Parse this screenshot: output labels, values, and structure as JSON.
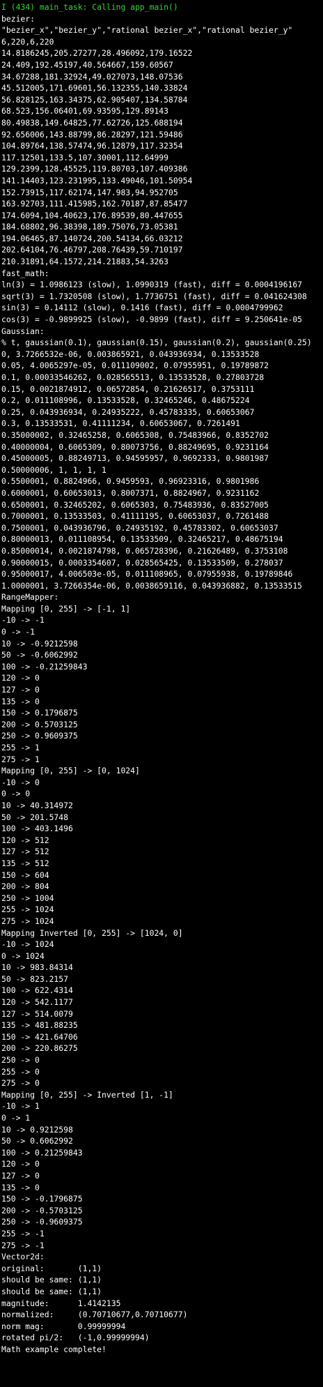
{
  "header": {
    "text": "I (434) main_task: Calling app_main()",
    "color": "#2fd92f"
  },
  "text_color": "#ffffff",
  "background": "#000000",
  "lines": [
    "bezier:",
    "\"bezier_x\",\"bezier_y\",\"rational bezier_x\",\"rational bezier_y\"",
    "6,220,6,220",
    "14.8186245,205.27277,28.496092,179.16522",
    "24.409,192.45197,40.564667,159.60567",
    "34.67288,181.32924,49.027073,148.07536",
    "45.512005,171.69601,56.132355,140.33824",
    "56.828125,163.34375,62.905407,134.58784",
    "68.523,156.06401,69.93595,129.89143",
    "80.49838,149.64825,77.62726,125.688194",
    "92.656006,143.88799,86.28297,121.59486",
    "104.89764,138.57474,96.12879,117.32354",
    "117.12501,133.5,107.30001,112.64999",
    "129.2399,128.45525,119.80703,107.409386",
    "141.14403,123.231995,133.49046,101.50954",
    "152.73915,117.62174,147.983,94.952705",
    "163.92703,111.415985,162.70187,87.85477",
    "174.6094,104.40623,176.89539,80.447655",
    "184.68802,96.38398,189.75076,73.05381",
    "194.06465,87.140724,200.54134,66.03212",
    "202.64104,76.46797,208.76439,59.710197",
    "210.31891,64.1572,214.21883,54.3263",
    "fast_math:",
    "ln(3) = 1.0986123 (slow), 1.0990319 (fast), diff = 0.0004196167",
    "sqrt(3) = 1.7320508 (slow), 1.7736751 (fast), diff = 0.041624308",
    "sin(3) = 0.14112 (slow), 0.1416 (fast), diff = 0.0004799962",
    "cos(3) = -0.9899925 (slow), -0.9899 (fast), diff = 9.250641e-05",
    "Gaussian:",
    "% t, gaussian(0.1), gaussian(0.15), gaussian(0.2), gaussian(0.25)",
    "0, 3.7266532e-06, 0.003865921, 0.043936934, 0.13533528",
    "0.05, 4.0065297e-05, 0.011109002, 0.07955951, 0.19789872",
    "0.1, 0.00033546262, 0.028565513, 0.13533528, 0.27803728",
    "0.15, 0.0021874912, 0.06572854, 0.21626517, 0.3753111",
    "0.2, 0.011108996, 0.13533528, 0.32465246, 0.48675224",
    "0.25, 0.043936934, 0.24935222, 0.45783335, 0.60653067",
    "0.3, 0.13533531, 0.41111234, 0.60653067, 0.7261491",
    "0.35000002, 0.32465258, 0.6065308, 0.75483966, 0.8352702",
    "0.40000004, 0.6065309, 0.80073756, 0.88249695, 0.9231164",
    "0.45000005, 0.88249713, 0.94595957, 0.9692333, 0.9801987",
    "0.50000006, 1, 1, 1, 1",
    "0.5500001, 0.8824966, 0.9459593, 0.96923316, 0.9801986",
    "0.6000001, 0.60653013, 0.8007371, 0.8824967, 0.9231162",
    "0.6500001, 0.32465202, 0.6065303, 0.75483936, 0.83527005",
    "0.7000001, 0.13533503, 0.41111195, 0.60653037, 0.7261488",
    "0.7500001, 0.043936796, 0.24935192, 0.45783302, 0.60653037",
    "0.80000013, 0.011108954, 0.13533509, 0.32465217, 0.48675194",
    "0.85000014, 0.0021874798, 0.065728396, 0.21626489, 0.3753108",
    "0.90000015, 0.0003354607, 0.028565425, 0.13533509, 0.278037",
    "0.95000017, 4.006503e-05, 0.011108965, 0.07955938, 0.19789846",
    "1.0000001, 3.7266354e-06, 0.0038659116, 0.043936882, 0.13533515",
    "RangeMapper:",
    "Mapping [0, 255] -> [-1, 1]",
    "-10 -> -1",
    "0 -> -1",
    "10 -> -0.9212598",
    "50 -> -0.6062992",
    "100 -> -0.21259843",
    "120 -> 0",
    "127 -> 0",
    "135 -> 0",
    "150 -> 0.1796875",
    "200 -> 0.5703125",
    "250 -> 0.9609375",
    "255 -> 1",
    "275 -> 1",
    "Mapping [0, 255] -> [0, 1024]",
    "-10 -> 0",
    "0 -> 0",
    "10 -> 40.314972",
    "50 -> 201.5748",
    "100 -> 403.1496",
    "120 -> 512",
    "127 -> 512",
    "135 -> 512",
    "150 -> 604",
    "200 -> 804",
    "250 -> 1004",
    "255 -> 1024",
    "275 -> 1024",
    "Mapping Inverted [0, 255] -> [1024, 0]",
    "-10 -> 1024",
    "0 -> 1024",
    "10 -> 983.84314",
    "50 -> 823.2157",
    "100 -> 622.4314",
    "120 -> 542.1177",
    "127 -> 514.0079",
    "135 -> 481.88235",
    "150 -> 421.64706",
    "200 -> 220.86275",
    "250 -> 0",
    "255 -> 0",
    "275 -> 0",
    "Mapping [0, 255] -> Inverted [1, -1]",
    "-10 -> 1",
    "0 -> 1",
    "10 -> 0.9212598",
    "50 -> 0.6062992",
    "100 -> 0.21259843",
    "120 -> 0",
    "127 -> 0",
    "135 -> 0",
    "150 -> -0.1796875",
    "200 -> -0.5703125",
    "250 -> -0.9609375",
    "255 -> -1",
    "275 -> -1",
    "Vector2d:",
    "original:       (1,1)",
    "should be same: (1,1)",
    "should be same: (1,1)",
    "magnitude:      1.4142135",
    "normalized:     (0.70710677,0.70710677)",
    "norm mag:       0.99999994",
    "rotated pi/2:   (-1,0.99999994)",
    "Math example complete!"
  ]
}
